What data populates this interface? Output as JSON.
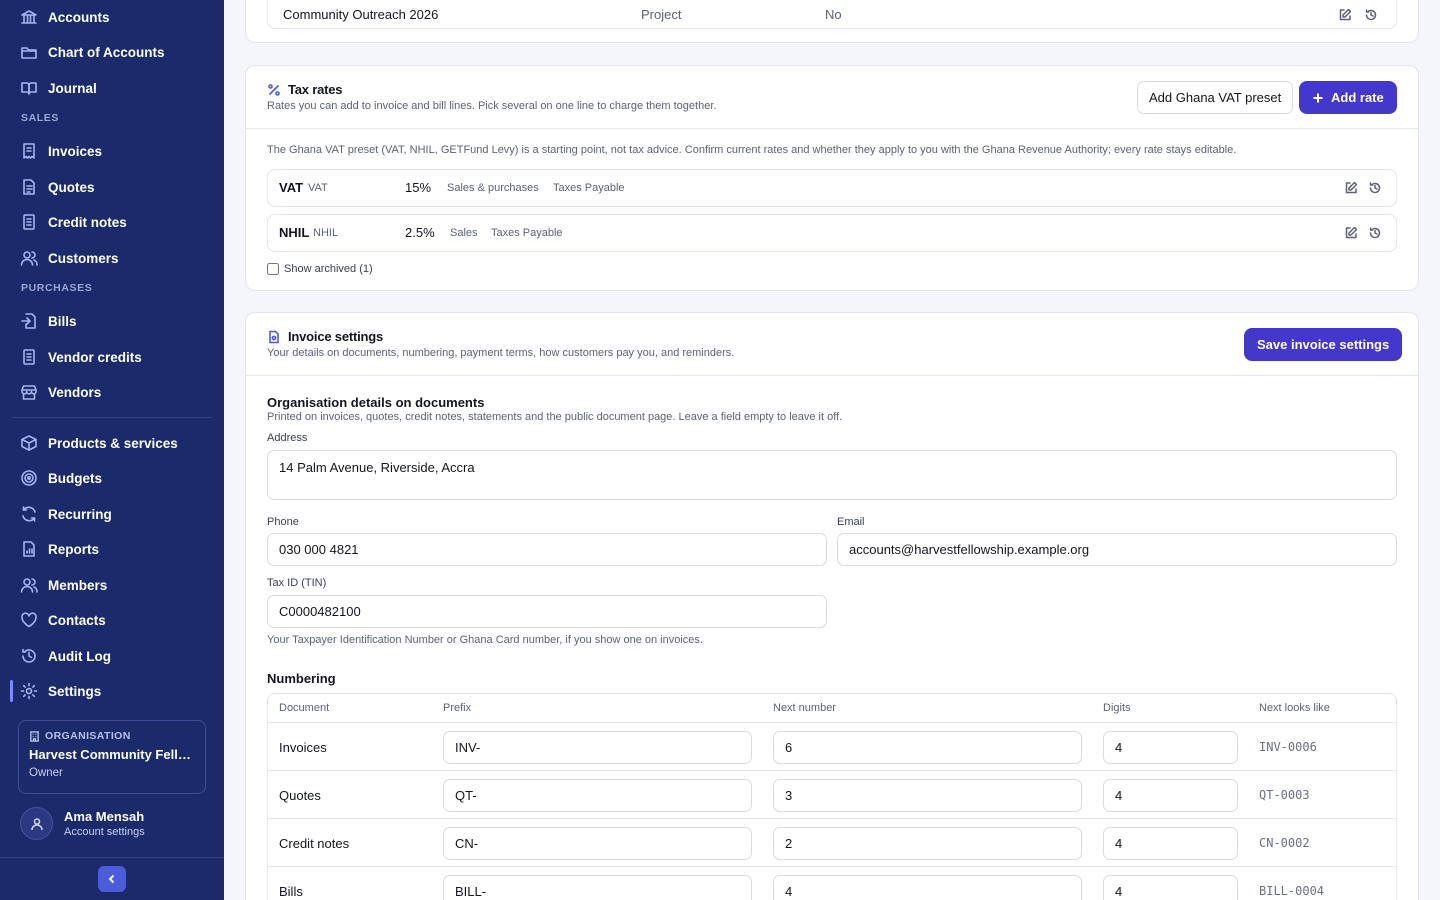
{
  "sidebar": {
    "items": [
      {
        "label": "Accounts",
        "icon": "bank-icon"
      },
      {
        "label": "Chart of Accounts",
        "icon": "folder-icon"
      },
      {
        "label": "Journal",
        "icon": "book-open-icon"
      },
      {
        "label": "Invoices",
        "icon": "receipt-icon"
      },
      {
        "label": "Quotes",
        "icon": "file-text-icon"
      },
      {
        "label": "Credit notes",
        "icon": "file-lines-icon"
      },
      {
        "label": "Customers",
        "icon": "users-icon"
      },
      {
        "label": "Bills",
        "icon": "file-import-icon"
      },
      {
        "label": "Vendor credits",
        "icon": "file-lines-icon"
      },
      {
        "label": "Vendors",
        "icon": "store-icon"
      },
      {
        "label": "Products & services",
        "icon": "box-icon"
      },
      {
        "label": "Budgets",
        "icon": "target-icon"
      },
      {
        "label": "Recurring",
        "icon": "refresh-icon"
      },
      {
        "label": "Reports",
        "icon": "file-chart-icon"
      },
      {
        "label": "Members",
        "icon": "users-icon"
      },
      {
        "label": "Contacts",
        "icon": "heart-icon"
      },
      {
        "label": "Audit Log",
        "icon": "history-icon"
      },
      {
        "label": "Settings",
        "icon": "gear-icon"
      }
    ],
    "sections": {
      "sales": "SALES",
      "purchases": "PURCHASES"
    },
    "active": "Settings",
    "organisation": {
      "label": "ORGANISATION",
      "name": "Harvest Community Fello...",
      "role": "Owner"
    },
    "user": {
      "name": "Ama Mensah",
      "sub": "Account settings"
    }
  },
  "tracking_row": {
    "name": "Community Outreach 2026",
    "type": "Project",
    "value": "No"
  },
  "tax_rates": {
    "title": "Tax rates",
    "subtitle": "Rates you can add to invoice and bill lines. Pick several on one line to charge them together.",
    "preset_button": "Add Ghana VAT preset",
    "add_button": "Add rate",
    "notice": "The Ghana VAT preset (VAT, NHIL, GETFund Levy) is a starting point, not tax advice. Confirm current rates and whether they apply to you with the Ghana Revenue Authority; every rate stays editable.",
    "rates": [
      {
        "name": "VAT",
        "code": "VAT",
        "rate": "15%",
        "applies": "Sales & purchases",
        "account": "Taxes Payable"
      },
      {
        "name": "NHIL",
        "code": "NHIL",
        "rate": "2.5%",
        "applies": "Sales",
        "account": "Taxes Payable"
      }
    ],
    "show_archived": "Show archived (1)"
  },
  "invoice_settings": {
    "title": "Invoice settings",
    "subtitle": "Your details on documents, numbering, payment terms, how customers pay you, and reminders.",
    "save_button": "Save invoice settings",
    "org_details": {
      "heading": "Organisation details on documents",
      "description": "Printed on invoices, quotes, credit notes, statements and the public document page. Leave a field empty to leave it off.",
      "address_label": "Address",
      "address": "14 Palm Avenue, Riverside, Accra",
      "phone_label": "Phone",
      "phone": "030 000 4821",
      "email_label": "Email",
      "email": "accounts@harvestfellowship.example.org",
      "tin_label": "Tax ID (TIN)",
      "tin": "C0000482100",
      "tin_hint": "Your Taxpayer Identification Number or Ghana Card number, if you show one on invoices."
    },
    "numbering": {
      "heading": "Numbering",
      "columns": [
        "Document",
        "Prefix",
        "Next number",
        "Digits",
        "Next looks like"
      ],
      "rows": [
        {
          "document": "Invoices",
          "prefix": "INV-",
          "next": "6",
          "digits": "4",
          "preview": "INV-0006"
        },
        {
          "document": "Quotes",
          "prefix": "QT-",
          "next": "3",
          "digits": "4",
          "preview": "QT-0003"
        },
        {
          "document": "Credit notes",
          "prefix": "CN-",
          "next": "2",
          "digits": "4",
          "preview": "CN-0002"
        },
        {
          "document": "Bills",
          "prefix": "BILL-",
          "next": "4",
          "digits": "4",
          "preview": "BILL-0004"
        }
      ]
    }
  },
  "colors": {
    "sidebar": "#1b2a6b",
    "accent": "#4338ca",
    "active_marker": "#7b8cff"
  }
}
